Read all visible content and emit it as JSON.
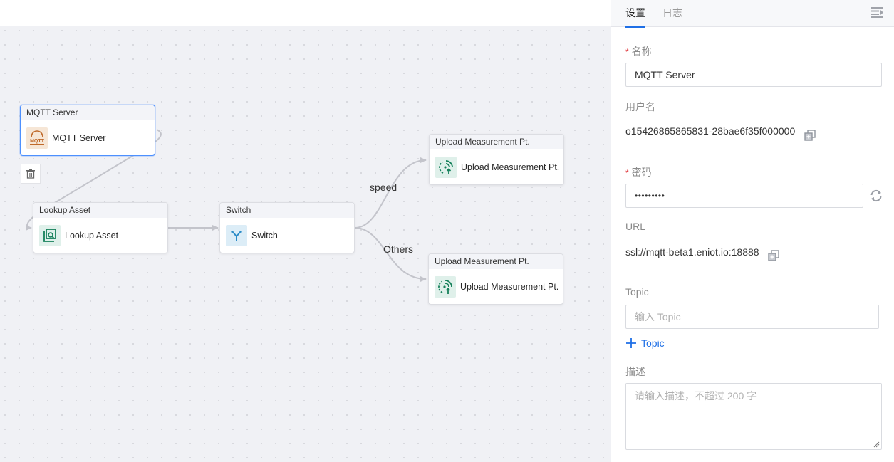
{
  "canvas": {
    "nodes": [
      {
        "id": "mqtt",
        "title": "MQTT Server",
        "label": "MQTT Server",
        "icon": "mqtt-icon",
        "icon_bg": "#f6e6d6",
        "selected": true
      },
      {
        "id": "lookup",
        "title": "Lookup Asset",
        "label": "Lookup Asset",
        "icon": "lookup-asset-icon",
        "icon_bg": "#dff0ea"
      },
      {
        "id": "switch",
        "title": "Switch",
        "label": "Switch",
        "icon": "switch-icon",
        "icon_bg": "#dcedf7"
      },
      {
        "id": "upload1",
        "title": "Upload Measurement Pt.",
        "label": "Upload Measurement Pt.",
        "icon": "upload-measurement-icon",
        "icon_bg": "#dff0ea"
      },
      {
        "id": "upload2",
        "title": "Upload Measurement Pt.",
        "label": "Upload Measurement Pt.",
        "icon": "upload-measurement-icon",
        "icon_bg": "#dff0ea"
      }
    ],
    "edge_labels": {
      "speed": "speed",
      "others": "Others"
    },
    "delete_icon": "trash-icon"
  },
  "panel": {
    "tabs": [
      {
        "label": "设置",
        "active": true
      },
      {
        "label": "日志",
        "active": false
      }
    ],
    "collapse_icon": "collapse-panel-icon",
    "fields": {
      "name": {
        "label": "名称",
        "required": true,
        "value": "MQTT Server"
      },
      "username": {
        "label": "用户名",
        "value": "o15426865865831-28bae6f35f000000"
      },
      "password": {
        "label": "密码",
        "required": true,
        "value": "•••••••••"
      },
      "url": {
        "label": "URL",
        "value": "ssl://mqtt-beta1.eniot.io:18888"
      },
      "topic": {
        "label": "Topic",
        "placeholder": "输入 Topic",
        "add_label": "Topic"
      },
      "description": {
        "label": "描述",
        "placeholder": "请输入描述，不超过 200 字"
      }
    },
    "required_mark": "*",
    "accent": "#1e6fe6"
  }
}
